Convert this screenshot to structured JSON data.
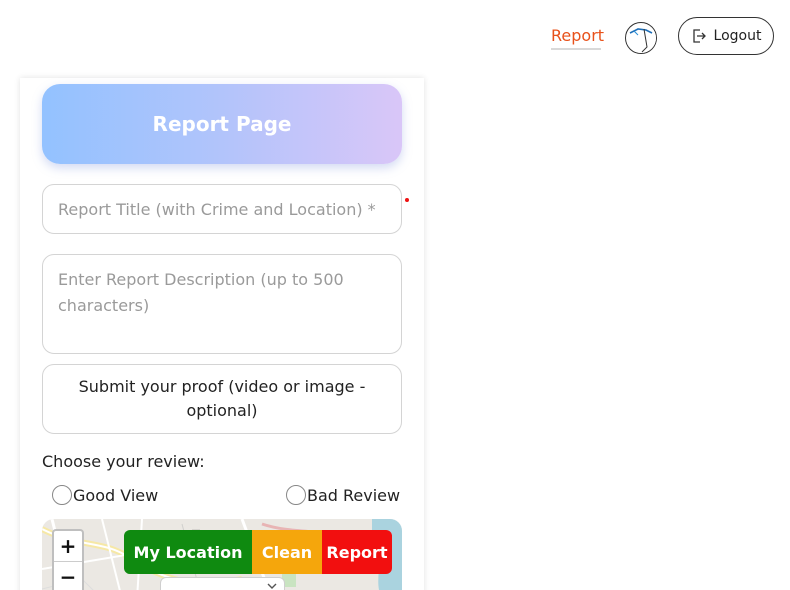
{
  "header": {
    "nav_report_label": "Report",
    "logout_label": "Logout"
  },
  "form": {
    "page_title": "Report Page",
    "title_placeholder": "Report Title (with Crime and Location) *",
    "description_placeholder": "Enter Report Description (up to 500 characters)",
    "proof_label": "Submit your proof (video or image - optional)",
    "review_label": "Choose your review:",
    "review_options": [
      {
        "label": "Good View"
      },
      {
        "label": "Bad Review"
      }
    ]
  },
  "map": {
    "zoom_in": "+",
    "zoom_out": "−",
    "my_location_label": "My Location",
    "clean_label": "Clean",
    "report_label": "Report"
  },
  "colors": {
    "accent": "#e8511a",
    "my_location": "#0f8a10",
    "clean": "#f5a60c",
    "report": "#f20f0f"
  },
  "icons": {
    "logout": "logout-icon",
    "avatar": "avatar-icon",
    "chevron": "chevron-down-icon"
  }
}
